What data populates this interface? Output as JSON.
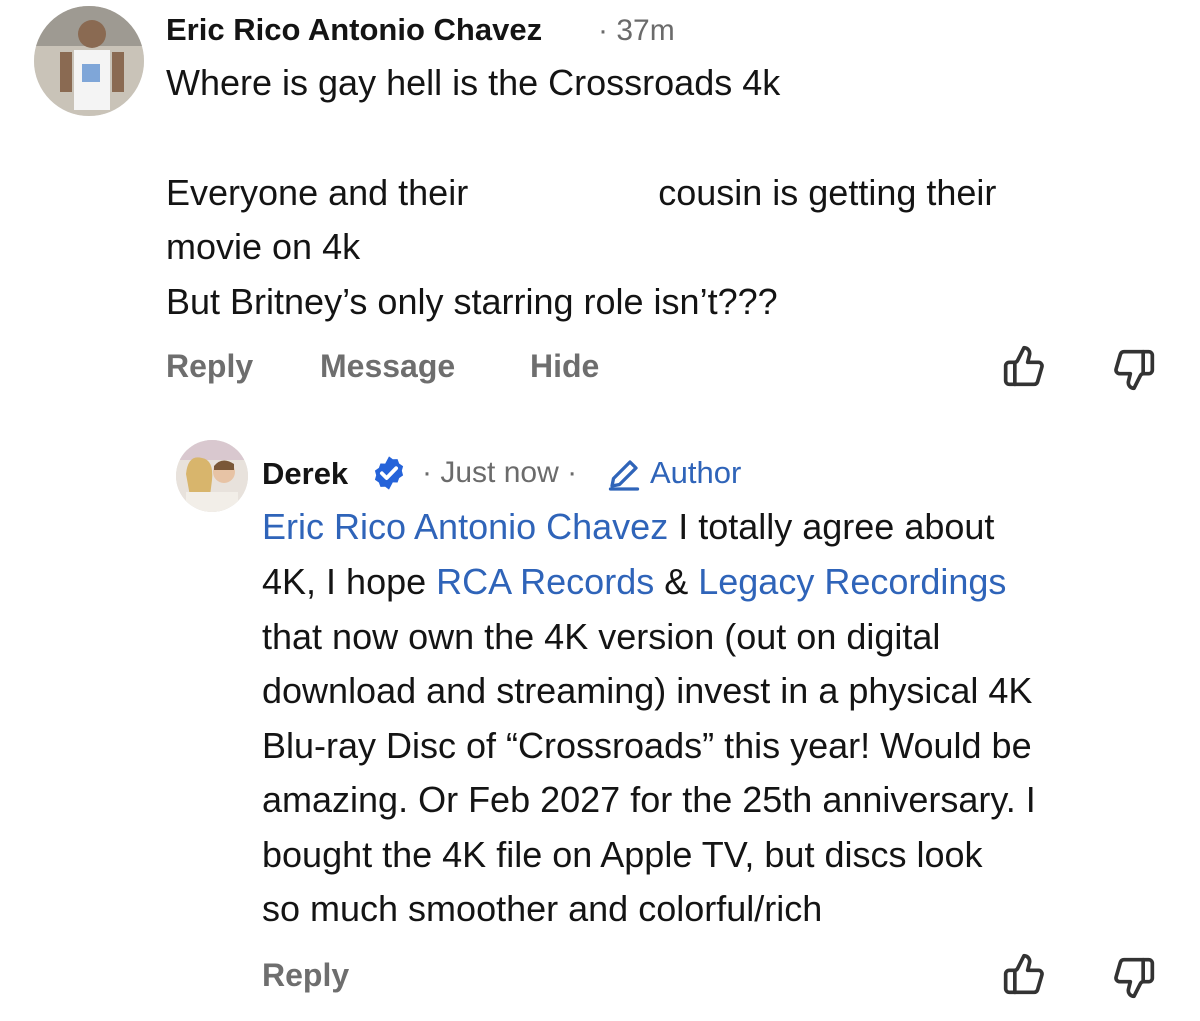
{
  "comment": {
    "author": "Eric Rico Antonio Chavez",
    "separator": "·",
    "time": "37m",
    "lines": [
      "Where is gay hell is the Crossroads 4k",
      "Everyone and their",
      "cousin is getting their",
      "movie on 4k",
      "But Britney’s only starring role isn’t???"
    ],
    "actions": {
      "reply": "Reply",
      "message": "Message",
      "hide": "Hide"
    }
  },
  "reply": {
    "author": "Derek",
    "sep1": "·",
    "time": "Just now",
    "sep2": "·",
    "author_badge": "Author",
    "mention1": "Eric Rico Antonio Chavez",
    "text1": " I totally agree about",
    "text2": "4K, I hope ",
    "mention2": "RCA Records",
    "text3": " & ",
    "mention3": "Legacy Recordings",
    "lines": [
      "that now own the 4K version (out on digital",
      "download and streaming) invest in a physical 4K",
      "Blu-ray Disc of “Crossroads” this year! Would be",
      "amazing. Or Feb 2027 for the 25th anniversary. I",
      "bought the 4K file on Apple TV, but discs look",
      "so much smoother and colorful/rich"
    ],
    "actions": {
      "reply": "Reply"
    }
  },
  "icons": {
    "like": "thumbs-up-icon",
    "dislike": "thumbs-down-icon",
    "verified": "verified-badge-icon",
    "pencil": "pencil-icon"
  },
  "colors": {
    "link": "#2f64b9",
    "verified": "#2563d9",
    "muted": "#6e6e6e"
  }
}
